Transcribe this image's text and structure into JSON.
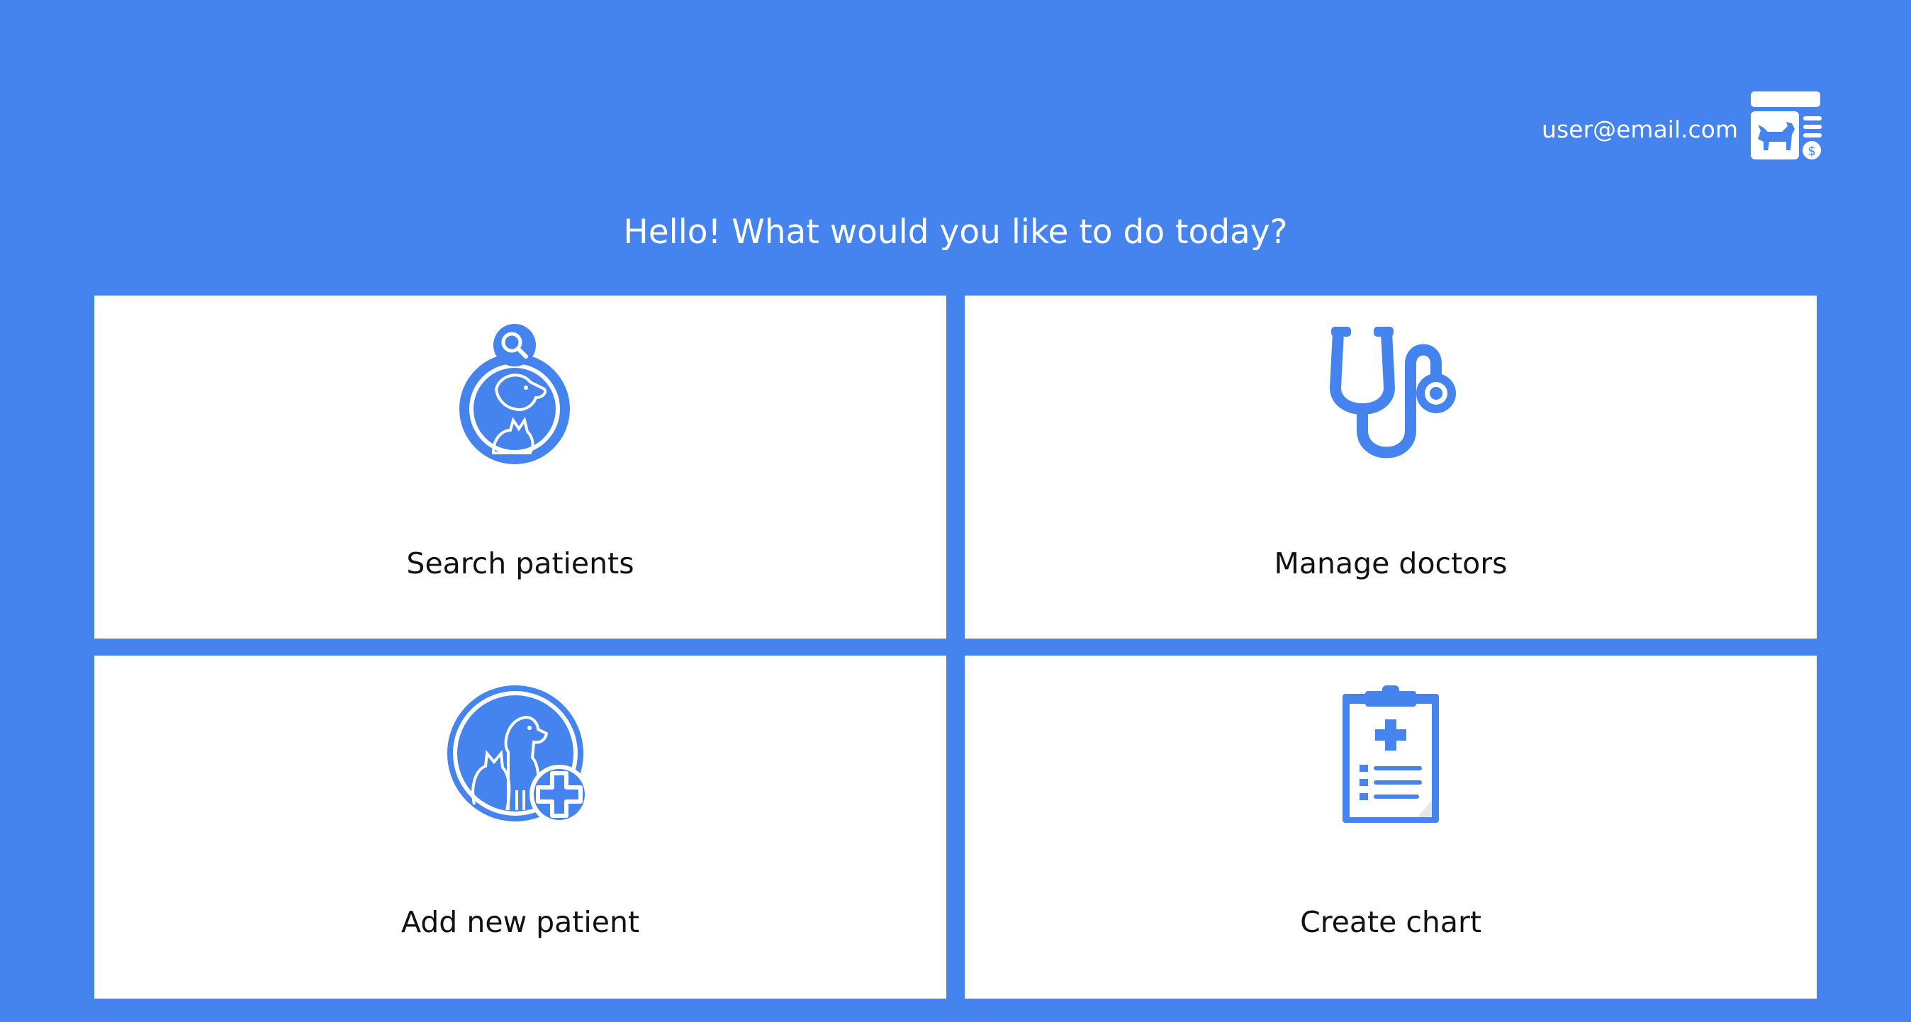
{
  "header": {
    "user_email": "user@email.com",
    "logo_icon": "vet-clinic-logo-icon"
  },
  "greeting": "Hello! What would you like to do today?",
  "actions": [
    {
      "label": "Search patients",
      "icon": "search-pets-icon"
    },
    {
      "label": "Manage doctors",
      "icon": "stethoscope-icon"
    },
    {
      "label": "Add new patient",
      "icon": "add-pet-icon"
    },
    {
      "label": "Create chart",
      "icon": "medical-chart-icon"
    }
  ],
  "colors": {
    "background": "#4583ef",
    "card": "#ffffff",
    "accent": "#4583ef",
    "text_dark": "#111111",
    "text_light": "#ffffff"
  }
}
